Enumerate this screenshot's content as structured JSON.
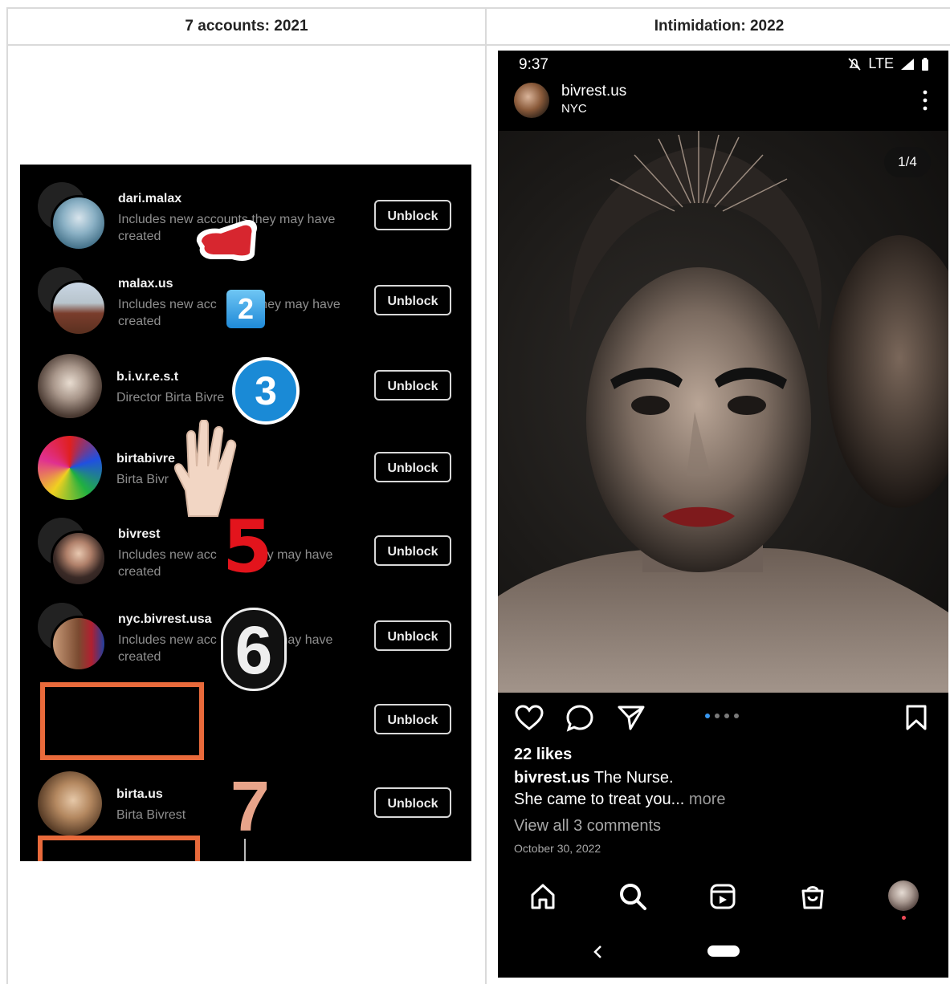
{
  "headers": {
    "left": "7 accounts: 2021",
    "right": "Intimidation: 2022"
  },
  "blocked_list": {
    "unblock_label": "Unblock",
    "rows": [
      {
        "username": "dari.malax",
        "sub1": "Includes new accounts they may have",
        "sub2": "created"
      },
      {
        "username": "malax.us",
        "sub1": "Includes new acc",
        "sub1b": "they may have",
        "sub2": "created"
      },
      {
        "username": "b.i.v.r.e.s.t",
        "sub1": "Director Birta Bivre",
        "sub2": ""
      },
      {
        "username": "birtabivre",
        "sub1": "Birta Bivr",
        "sub2": ""
      },
      {
        "username": "bivrest",
        "sub1": "Includes new acc",
        "sub1b": "ey may have",
        "sub2": "created"
      },
      {
        "username": "nyc.bivrest.usa",
        "sub1": "Includes new acc",
        "sub1b": "ey may have",
        "sub2": "created"
      },
      {
        "username": "",
        "sub1": "",
        "sub2": ""
      },
      {
        "username": "birta.us",
        "sub1": "Birta Bivrest",
        "sub2": ""
      }
    ],
    "stickers": {
      "two": "2",
      "three": "3",
      "five": "5",
      "six": "6",
      "seven": "7"
    }
  },
  "post": {
    "status": {
      "time": "9:37",
      "network": "LTE"
    },
    "username": "bivrest.us",
    "location": "NYC",
    "image_counter": "1/4",
    "carousel_position": {
      "current": 1,
      "total": 4
    },
    "likes": "22 likes",
    "caption_user": "bivrest.us",
    "caption_text": "The Nurse.",
    "caption_line2": "She came to treat you...",
    "more_label": "more",
    "view_comments": "View all 3 comments",
    "date": "October 30, 2022"
  },
  "colors": {
    "accent_blue": "#3897f0",
    "redaction_orange": "#e96a3b",
    "notification_red": "#ed4956"
  },
  "icons": [
    "heart-icon",
    "comment-icon",
    "share-icon",
    "bookmark-icon",
    "home-icon",
    "search-icon",
    "reels-icon",
    "shop-icon",
    "profile-avatar",
    "back-icon"
  ]
}
